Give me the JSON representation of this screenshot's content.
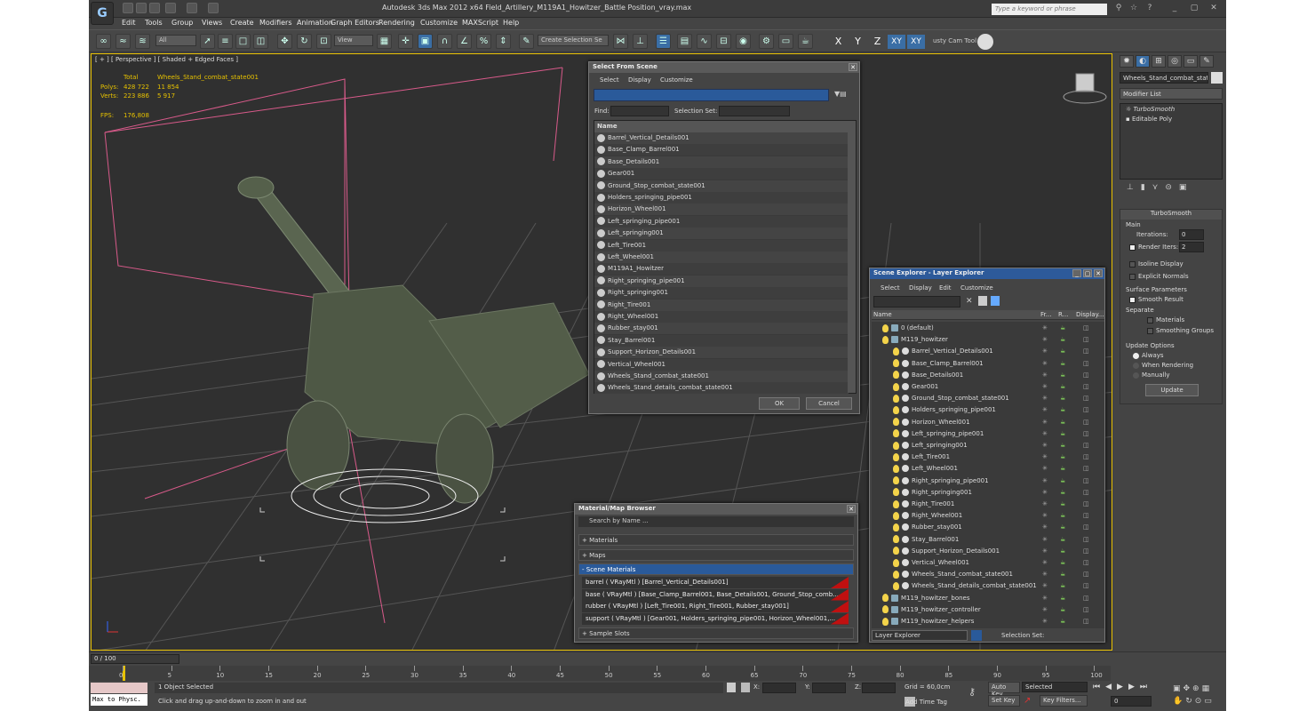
{
  "app": {
    "title": "Autodesk 3ds Max  2012 x64     Field_Artillery_M119A1_Howitzer_Battle Position_vray.max",
    "search_placeholder": "Type a keyword or phrase",
    "logo": "3ds-max-logo"
  },
  "menus": [
    "Edit",
    "Tools",
    "Group",
    "Views",
    "Create",
    "Modifiers",
    "Animation",
    "Graph Editors",
    "Rendering",
    "Customize",
    "MAXScript",
    "Help"
  ],
  "toolbar": {
    "filter": "All",
    "view": "View",
    "selection_set_placeholder": "Create Selection Se",
    "axes": [
      "X",
      "Y",
      "Z",
      "XY",
      "XY"
    ],
    "extra": "usty Cam Tool"
  },
  "viewport": {
    "label": "[ + ] [ Perspective ] [ Shaded + Edged Faces ]",
    "stats": {
      "total_label": "Total",
      "object_name": "Wheels_Stand_combat_state001",
      "polys_label": "Polys:",
      "polys_total": "428 722",
      "polys_sel": "11 854",
      "verts_label": "Verts:",
      "verts_total": "223 886",
      "verts_sel": "5 917",
      "fps_label": "FPS:",
      "fps": "176,808"
    }
  },
  "select_from_scene": {
    "title": "Select From Scene",
    "menus": [
      "Select",
      "Display",
      "Customize"
    ],
    "find_label": "Find:",
    "selection_set_label": "Selection Set:",
    "column": "Name",
    "items": [
      "Barrel_Vertical_Details001",
      "Base_Clamp_Barrel001",
      "Base_Details001",
      "Gear001",
      "Ground_Stop_combat_state001",
      "Holders_springing_pipe001",
      "Horizon_Wheel001",
      "Left_springing_pipe001",
      "Left_springing001",
      "Left_Tire001",
      "Left_Wheel001",
      "M119A1_Howitzer",
      "Right_springing_pipe001",
      "Right_springing001",
      "Right_Tire001",
      "Right_Wheel001",
      "Rubber_stay001",
      "Stay_Barrel001",
      "Support_Horizon_Details001",
      "Vertical_Wheel001",
      "Wheels_Stand_combat_state001",
      "Wheels_Stand_details_combat_state001"
    ],
    "ok": "OK",
    "cancel": "Cancel"
  },
  "material_browser": {
    "title": "Material/Map Browser",
    "search": "Search by Name ...",
    "materials": "+ Materials",
    "maps": "+ Maps",
    "scene_materials": "- Scene Materials",
    "rows": [
      "barrel  ( VRayMtl ) [Barrel_Vertical_Details001]",
      "base  ( VRayMtl ) [Base_Clamp_Barrel001, Base_Details001, Ground_Stop_comb...",
      "rubber  ( VRayMtl ) [Left_Tire001, Right_Tire001, Rubber_stay001]",
      "support  ( VRayMtl ) [Gear001, Holders_springing_pipe001, Horizon_Wheel001,..."
    ],
    "sample_slots": "+ Sample Slots"
  },
  "scene_explorer": {
    "title": "Scene Explorer - Layer Explorer",
    "menus": [
      "Select",
      "Display",
      "Edit",
      "Customize"
    ],
    "columns": [
      "Name",
      "Fr...",
      "R...",
      "Display..."
    ],
    "layers": [
      {
        "name": "0 (default)",
        "indent": 0,
        "type": "layer"
      },
      {
        "name": "M119_howitzer",
        "indent": 0,
        "type": "layer"
      },
      {
        "name": "Barrel_Vertical_Details001",
        "indent": 1,
        "type": "obj"
      },
      {
        "name": "Base_Clamp_Barrel001",
        "indent": 1,
        "type": "obj"
      },
      {
        "name": "Base_Details001",
        "indent": 1,
        "type": "obj"
      },
      {
        "name": "Gear001",
        "indent": 1,
        "type": "obj"
      },
      {
        "name": "Ground_Stop_combat_state001",
        "indent": 1,
        "type": "obj"
      },
      {
        "name": "Holders_springing_pipe001",
        "indent": 1,
        "type": "obj"
      },
      {
        "name": "Horizon_Wheel001",
        "indent": 1,
        "type": "obj"
      },
      {
        "name": "Left_springing_pipe001",
        "indent": 1,
        "type": "obj"
      },
      {
        "name": "Left_springing001",
        "indent": 1,
        "type": "obj"
      },
      {
        "name": "Left_Tire001",
        "indent": 1,
        "type": "obj"
      },
      {
        "name": "Left_Wheel001",
        "indent": 1,
        "type": "obj"
      },
      {
        "name": "Right_springing_pipe001",
        "indent": 1,
        "type": "obj"
      },
      {
        "name": "Right_springing001",
        "indent": 1,
        "type": "obj"
      },
      {
        "name": "Right_Tire001",
        "indent": 1,
        "type": "obj"
      },
      {
        "name": "Right_Wheel001",
        "indent": 1,
        "type": "obj"
      },
      {
        "name": "Rubber_stay001",
        "indent": 1,
        "type": "obj"
      },
      {
        "name": "Stay_Barrel001",
        "indent": 1,
        "type": "obj"
      },
      {
        "name": "Support_Horizon_Details001",
        "indent": 1,
        "type": "obj"
      },
      {
        "name": "Vertical_Wheel001",
        "indent": 1,
        "type": "obj"
      },
      {
        "name": "Wheels_Stand_combat_state001",
        "indent": 1,
        "type": "obj"
      },
      {
        "name": "Wheels_Stand_details_combat_state001",
        "indent": 1,
        "type": "obj"
      },
      {
        "name": "M119_howitzer_bones",
        "indent": 0,
        "type": "layer"
      },
      {
        "name": "M119_howitzer_controller",
        "indent": 0,
        "type": "layer"
      },
      {
        "name": "M119_howitzer_helpers",
        "indent": 0,
        "type": "layer"
      }
    ],
    "footer_dropdown": "Layer Explorer",
    "selection_set_label": "Selection Set:"
  },
  "command_panel": {
    "object_name": "Wheels_Stand_combat_state",
    "modifier_list": "Modifier List",
    "stack": [
      "TurboSmooth",
      "Editable Poly"
    ],
    "turbosmooth_title": "TurboSmooth",
    "main_label": "Main",
    "iterations_label": "Iterations:",
    "iterations_value": "0",
    "render_iters_label": "Render Iters:",
    "render_iters_value": "2",
    "isoline_label": "Isoline Display",
    "explicit_label": "Explicit Normals",
    "surface_params_label": "Surface Parameters",
    "smooth_result_label": "Smooth Result",
    "separate_label": "Separate",
    "materials_label": "Materials",
    "smoothing_groups_label": "Smoothing Groups",
    "update_options_label": "Update Options",
    "always_label": "Always",
    "when_rendering_label": "When Rendering",
    "manually_label": "Manually",
    "update_button": "Update"
  },
  "timeline": {
    "frame": "0 / 100",
    "ticks": [
      "0",
      "5",
      "10",
      "15",
      "20",
      "25",
      "30",
      "35",
      "40",
      "45",
      "50",
      "55",
      "60",
      "65",
      "70",
      "75",
      "80",
      "85",
      "90",
      "95",
      "100"
    ]
  },
  "status": {
    "maxscript": "Max to Physc.",
    "selected": "1 Object Selected",
    "hint": "Click and drag up-and-down to zoom in and out",
    "x_label": "X:",
    "y_label": "Y:",
    "z_label": "Z:",
    "grid": "Grid = 60,0cm",
    "add_time_tag": "Add Time Tag",
    "auto_key": "Auto Key",
    "set_key": "Set Key",
    "selected_dropdown": "Selected",
    "key_filters": "Key Filters...",
    "frame_value": "0"
  }
}
